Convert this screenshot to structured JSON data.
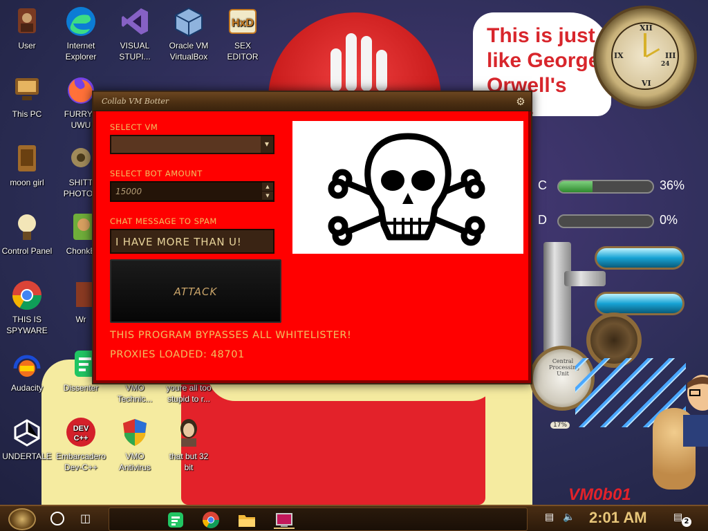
{
  "desktop": {
    "icons": [
      {
        "label": "User",
        "icon": "user-folder-icon"
      },
      {
        "label": "Internet\nExplorer",
        "icon": "edge-icon"
      },
      {
        "label": "VISUAL\nSTUPI...",
        "icon": "visual-studio-icon"
      },
      {
        "label": "Oracle VM\nVirtualBox",
        "icon": "virtualbox-icon"
      },
      {
        "label": "SEX\nEDITOR",
        "icon": "hex-editor-icon"
      },
      {
        "label": "This PC",
        "icon": "computer-icon"
      },
      {
        "label": "FURRYF\nUWU",
        "icon": "firefox-icon"
      },
      {
        "label": "moon girl",
        "icon": "file-icon"
      },
      {
        "label": "SHITT\nPHOTOS",
        "icon": "photos-icon"
      },
      {
        "label": "Control Panel",
        "icon": "control-panel-icon"
      },
      {
        "label": "ChonkB",
        "icon": "game-icon"
      },
      {
        "label": "THIS IS\nSPYWARE",
        "icon": "chrome-icon"
      },
      {
        "label": "Wr",
        "icon": "app-icon"
      },
      {
        "label": "Audacity",
        "icon": "audacity-icon"
      },
      {
        "label": "Dissenter",
        "icon": "dissenter-icon"
      },
      {
        "label": "VMO\nTechnic...",
        "icon": "document-icon"
      },
      {
        "label": "youre all too\nstupid to r...",
        "icon": "document-icon"
      },
      {
        "label": "UNDERTALE",
        "icon": "unity-icon"
      },
      {
        "label": "Embarcadero\nDev-C++",
        "icon": "devcpp-icon"
      },
      {
        "label": "VMO\nAntivirus",
        "icon": "shield-icon"
      },
      {
        "label": "that but 32\nbit",
        "icon": "portrait-icon"
      }
    ]
  },
  "wallpaper": {
    "note_text": "This is just like George Orwell's 1984",
    "gauges": [
      {
        "drive": "C",
        "percent": 36,
        "label": "36%"
      },
      {
        "drive": "D",
        "percent": 0,
        "label": "0%"
      }
    ],
    "dial_text": "Central\nProcessing\nUnit",
    "dial_small": "17%",
    "signature": "VM0b01",
    "clock_numbers": [
      "XII",
      "III",
      "VI",
      "IX"
    ],
    "clock_inner": "24"
  },
  "app": {
    "title": "Collab VM Botter",
    "select_vm_label": "SELECT VM",
    "select_vm_value": "",
    "bot_amount_label": "SELECT BOT AMOUNT",
    "bot_amount_value": "15000",
    "chat_label": "CHAT MESSAGE TO SPAM",
    "chat_value": "I HAVE MORE THAN U!",
    "attack_label": "ATTACK",
    "status_bypass": "THIS PROGRAM BYPASSES ALL WHITELISTER!",
    "status_proxies": "PROXIES LOADED: 48701",
    "colors": {
      "background": "#ff0000",
      "label": "#f0c060",
      "titlebar": "#4a2e12"
    }
  },
  "taskbar": {
    "clock": "2:01 AM",
    "notification_count": "2",
    "pinned": [
      "dissenter-icon",
      "chrome-icon",
      "file-explorer-icon",
      "collab-vm-botter-icon"
    ]
  }
}
